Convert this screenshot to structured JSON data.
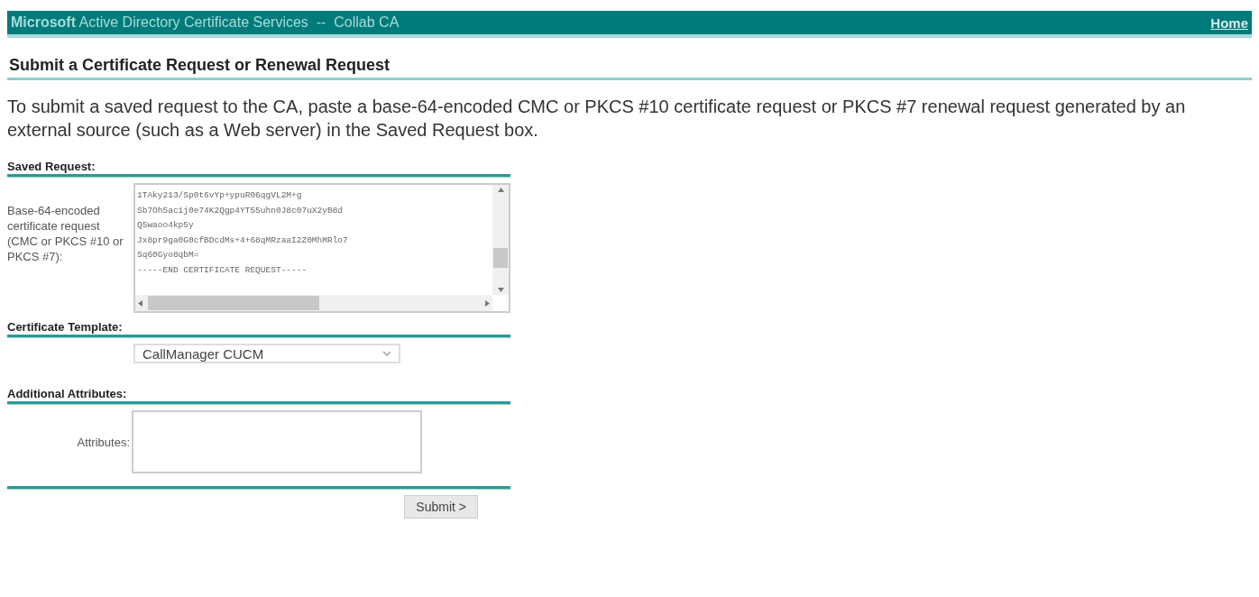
{
  "header": {
    "brand": "Microsoft",
    "title": "Active Directory Certificate Services  --  Collab CA",
    "home_link": "Home"
  },
  "page_title": "Submit a Certificate Request or Renewal Request",
  "intro": "To submit a saved request to the CA, paste a base-64-encoded CMC or PKCS #10 certificate request or PKCS #7 renewal request generated by an external source (such as a Web server) in the Saved Request box.",
  "sections": [
    {
      "kind": "request",
      "heading": "Saved Request:",
      "label": "Base-64-encoded certificate request (CMC or PKCS #10 or PKCS #7):",
      "lines": [
        "1TAky213/Sp0t6vYp+ypuR06qgVL2M+g",
        "Sb7Oh5ac1j0e74K2Qgp4YT55uhn0J8c07uX2yB8d",
        "Q5waoo4kp5y",
        "Jx8pr9ga0G0cfBDcdMs+4+68qMRzaaI2Z0MhMRlo7",
        "Sq60Gyo8qbM=",
        "-----END CERTIFICATE REQUEST-----"
      ]
    },
    {
      "kind": "template",
      "heading": "Certificate Template:",
      "value": "CallManager CUCM"
    },
    {
      "kind": "attributes",
      "heading": "Additional Attributes:",
      "label": "Attributes:"
    }
  ],
  "submit": "Submit >"
}
